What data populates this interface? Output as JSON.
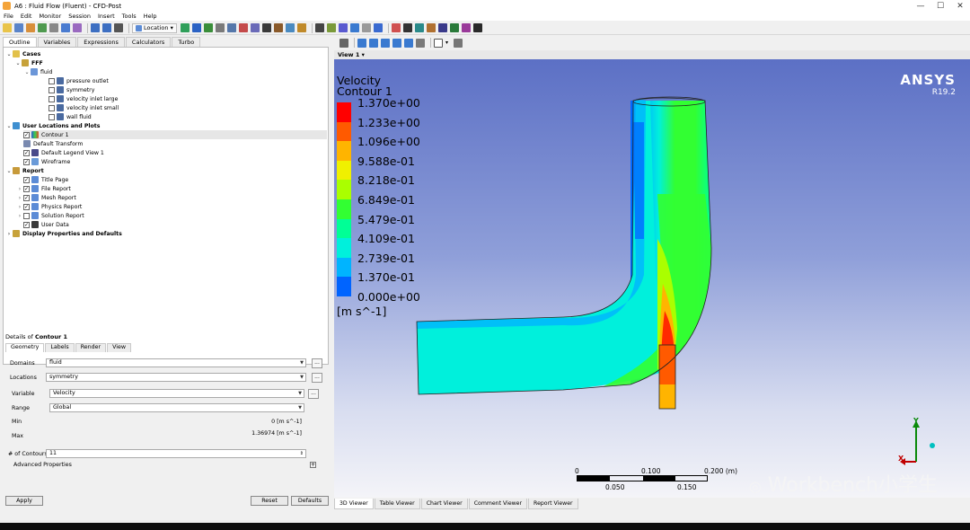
{
  "window": {
    "title": "A6 : Fluid Flow (Fluent) - CFD-Post"
  },
  "menu": [
    "File",
    "Edit",
    "Monitor",
    "Session",
    "Insert",
    "Tools",
    "Help"
  ],
  "toolbar": {
    "location_label": "Location"
  },
  "outline_tabs": [
    "Outline",
    "Variables",
    "Expressions",
    "Calculators",
    "Turbo"
  ],
  "tree": {
    "cases": "Cases",
    "fff": "FFF",
    "fluid": "fluid",
    "boundaries": [
      "pressure outlet",
      "symmetry",
      "velocity inlet large",
      "velocity inlet small",
      "wall fluid"
    ],
    "user_locations": "User Locations and Plots",
    "contour": "Contour 1",
    "default_transform": "Default Transform",
    "legend_view": "Default Legend View 1",
    "wireframe": "Wireframe",
    "report": "Report",
    "report_items": [
      "Title Page",
      "File Report",
      "Mesh Report",
      "Physics Report",
      "Solution Report",
      "User Data"
    ],
    "display_props": "Display Properties and Defaults"
  },
  "details": {
    "title_prefix": "Details of ",
    "title_object": "Contour 1",
    "tabs": [
      "Geometry",
      "Labels",
      "Render",
      "View"
    ],
    "domains_label": "Domains",
    "domains_value": "fluid",
    "locations_label": "Locations",
    "locations_value": "symmetry",
    "variable_label": "Variable",
    "variable_value": "Velocity",
    "range_label": "Range",
    "range_value": "Global",
    "min_label": "Min",
    "min_value": "0 [m s^-1]",
    "max_label": "Max",
    "max_value": "1.36974 [m s^-1]",
    "contours_label": "# of Contours",
    "contours_value": "11",
    "advanced_label": "Advanced Properties",
    "dots": "...",
    "apply": "Apply",
    "reset": "Reset",
    "defaults": "Defaults"
  },
  "viewer": {
    "view_tab": "View 1",
    "legend_title1": "Velocity",
    "legend_title2": "Contour 1",
    "legend_unit": "[m s^-1]",
    "legend_values": [
      "1.370e+00",
      "1.233e+00",
      "1.096e+00",
      "9.588e-01",
      "8.218e-01",
      "6.849e-01",
      "5.479e-01",
      "4.109e-01",
      "2.739e-01",
      "1.370e-01",
      "0.000e+00"
    ],
    "legend_colors": [
      "#ff0000",
      "#ff5a00",
      "#ffb400",
      "#f0f000",
      "#aaff00",
      "#32ff32",
      "#00ff96",
      "#00f0dc",
      "#00b4ff",
      "#0064ff",
      "#0014ff"
    ],
    "ansys_brand": "ANSYS",
    "ansys_version": "R19.2",
    "scale_top": [
      "0",
      "0.100",
      "0.200  (m)"
    ],
    "scale_bottom": [
      "0.050",
      "0.150"
    ],
    "axis_y": "Y",
    "axis_x": "X",
    "tabs": [
      "3D Viewer",
      "Table Viewer",
      "Chart Viewer",
      "Comment Viewer",
      "Report Viewer"
    ],
    "watermark": "Workbench小学生"
  }
}
